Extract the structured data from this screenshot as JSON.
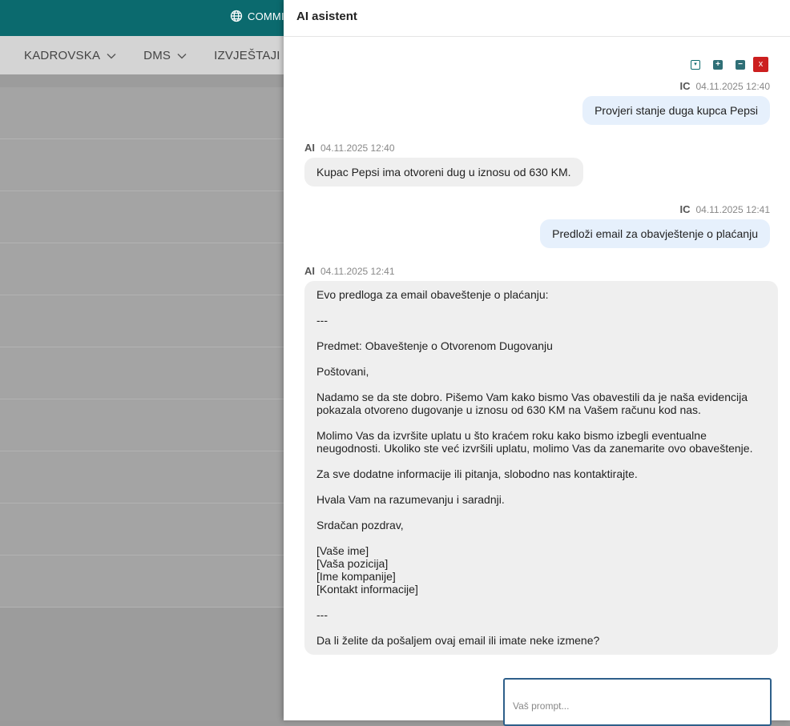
{
  "topbar": {
    "company_label": "COMMIT",
    "icon": "globe-icon"
  },
  "navbar": {
    "items": [
      {
        "label": "KADROVSKA",
        "icon": "chevron-down-icon"
      },
      {
        "label": "DMS",
        "icon": "chevron-down-icon"
      },
      {
        "label": "IZVJEŠTAJI",
        "icon": "chevron-down-icon"
      }
    ]
  },
  "panel": {
    "title": "AI asistent",
    "controls": {
      "collapse_label": "▾",
      "expand_label": "+",
      "shrink_label": "−",
      "close_label": "x",
      "close_color": "#cc1f1f"
    }
  },
  "messages": [
    {
      "who": "IC",
      "time": "04.11.2025 12:40",
      "text": "Provjeri stanje duga kupca Pepsi"
    },
    {
      "who": "AI",
      "time": "04.11.2025 12:40",
      "text": "Kupac Pepsi ima otvoreni dug u iznosu od 630 KM."
    },
    {
      "who": "IC",
      "time": "04.11.2025 12:41",
      "text": "Predloži email za obavještenje o plaćanju"
    },
    {
      "who": "AI",
      "time": "04.11.2025 12:41",
      "lines": [
        "Evo predloga za email obaveštenje o plaćanju:",
        "",
        "---",
        "",
        "Predmet: Obaveštenje o Otvorenom Dugovanju",
        "",
        "Poštovani,",
        "",
        "Nadamo se da ste dobro. Pišemo Vam kako bismo Vas obavestili da je naša evidencija",
        "pokazala otvoreno dugovanje u iznosu od 630 KM na Vašem računu kod nas.",
        "",
        "Molimo Vas da izvršite uplatu u što kraćem roku kako bismo izbegli eventualne",
        "neugodnosti. Ukoliko ste već izvršili uplatu, molimo Vas da zanemarite ovo obaveštenje.",
        "",
        "Za sve dodatne informacije ili pitanja, slobodno nas kontaktirajte.",
        "",
        "Hvala Vam na razumevanju i saradnji.",
        "",
        "Srdačan pozdrav,",
        "",
        "[Vaše ime]",
        "[Vaša pozicija]",
        "[Ime kompanije]",
        "[Kontakt informacije]",
        "",
        "---",
        "",
        "Da li želite da pošaljem ovaj email ili imate neke izmene?"
      ]
    }
  ],
  "prompt": {
    "placeholder": "Vaš prompt..."
  },
  "colors": {
    "topbar": "#0b6a6e",
    "user_bubble": "#e6f0fc",
    "ai_bubble": "#efefef"
  }
}
